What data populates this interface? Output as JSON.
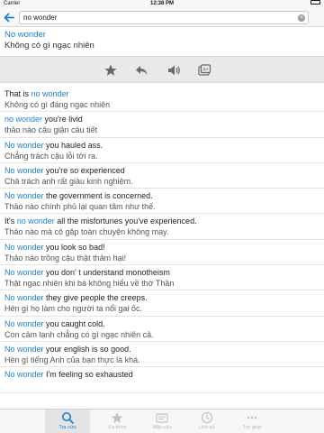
{
  "status_bar": {
    "carrier": "Carrier",
    "time": "12:38 PM",
    "battery_level": 1.0
  },
  "search": {
    "value": "no wonder"
  },
  "entry": {
    "term": "No wonder",
    "meaning": "Không có gì ngạc nhiên"
  },
  "toolbar": {
    "icons": [
      "star-icon",
      "share-arrow-icon",
      "speaker-icon",
      "flashcard-icon"
    ]
  },
  "examples": [
    {
      "pre": "That is ",
      "hl": "no wonder",
      "post": "",
      "vi": "Không có gì đáng ngạc nhiên"
    },
    {
      "pre": "",
      "hl": "no wonder",
      "post": " you're livid",
      "vi": "thảo nào cậu giận cáu tiết"
    },
    {
      "pre": "",
      "hl": "No wonder",
      "post": " you hauled ass.",
      "vi": "Chẳng trách cậu lỗi tới ra."
    },
    {
      "pre": "",
      "hl": "No wonder",
      "post": " you're so experienced",
      "vi": "Chả trách anh rất giàu kinh nghiệm."
    },
    {
      "pre": "",
      "hl": "No wonder",
      "post": " the government is concerned.",
      "vi": "Thảo nào chính phủ lại quan tâm như thế."
    },
    {
      "pre": "It's ",
      "hl": "no wonder",
      "post": " all the misfortunes you've experienced.",
      "vi": "Thảo nào mà cô gặp toàn chuyện không may."
    },
    {
      "pre": "",
      "hl": "No wonder",
      "post": " you look so bad!",
      "vi": "Thảo nào trông cậu thật thảm hại!"
    },
    {
      "pre": "",
      "hl": "No wonder",
      "post": " you don' t understand monotheism",
      "vi": "Thật ngạc nhiên khi bà không hiểu về thờ Thần"
    },
    {
      "pre": "",
      "hl": "No wonder",
      "post": " they give people the creeps.",
      "vi": "Hèn gì họ làm cho người ta nổi gai ốc."
    },
    {
      "pre": "",
      "hl": "No wonder",
      "post": " you caught cold.",
      "vi": "Con cảm lạnh chẳng có gì ngạc nhiên cả."
    },
    {
      "pre": "",
      "hl": "No wonder",
      "post": " your english is so good.",
      "vi": "Hèn gì tiếng Anh của bạn thực là khá."
    },
    {
      "pre": "",
      "hl": "No wonder",
      "post": " I'm feeling so exhausted",
      "vi": ""
    }
  ],
  "tabs": [
    {
      "label": "Tra cứu",
      "icon": "search-icon",
      "active": true
    },
    {
      "label": "Ưa thích",
      "icon": "star-icon",
      "active": false
    },
    {
      "label": "Mẫu câu",
      "icon": "phrasebook-icon",
      "active": false
    },
    {
      "label": "Lịch sử",
      "icon": "clock-icon",
      "active": false
    },
    {
      "label": "Trợ giúp",
      "icon": "more-icon",
      "active": false
    }
  ],
  "colors": {
    "accent": "#1e7ed6",
    "toolbar_bg": "#e9e9ea",
    "bar_bg": "#f7f7f7"
  }
}
